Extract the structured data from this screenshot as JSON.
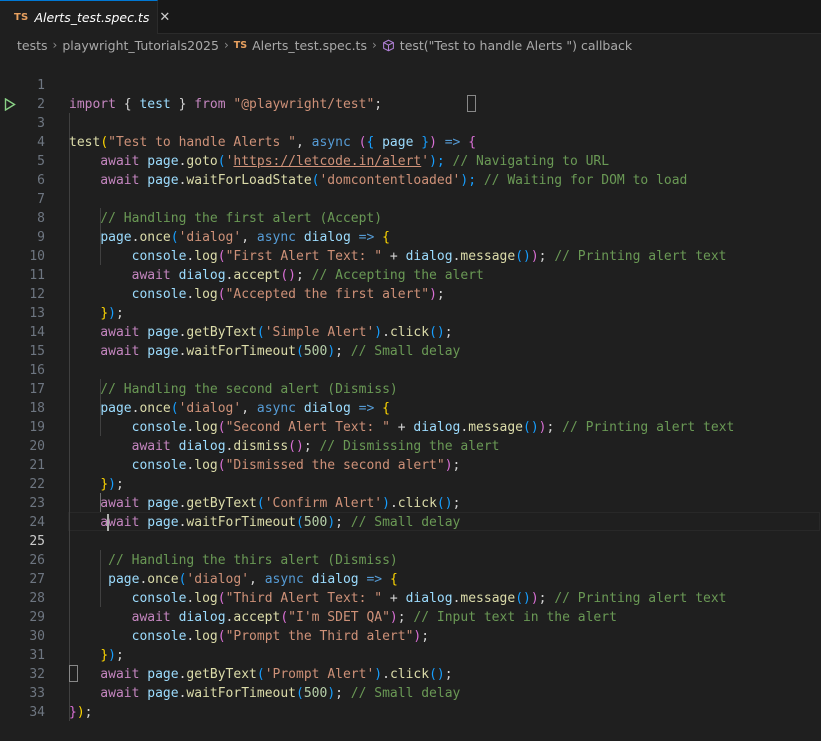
{
  "tab": {
    "badge": "TS",
    "title": "Alerts_test.spec.ts",
    "close": "✕"
  },
  "breadcrumb": {
    "items": [
      "tests",
      "playwright_Tutorials2025",
      "Alerts_test.spec.ts",
      "test(\"Test to handle Alerts \") callback"
    ],
    "ts_badge": "TS",
    "separator": "›"
  },
  "editor": {
    "active_line": 25,
    "lines": [
      {
        "n": "1"
      },
      {
        "n": "2"
      },
      {
        "n": "3"
      },
      {
        "n": "4"
      },
      {
        "n": "5"
      },
      {
        "n": "6"
      },
      {
        "n": "7"
      },
      {
        "n": "8"
      },
      {
        "n": "9"
      },
      {
        "n": "10"
      },
      {
        "n": "11"
      },
      {
        "n": "12"
      },
      {
        "n": "13"
      },
      {
        "n": "14"
      },
      {
        "n": "15"
      },
      {
        "n": "16"
      },
      {
        "n": "17"
      },
      {
        "n": "18"
      },
      {
        "n": "19"
      },
      {
        "n": "20"
      },
      {
        "n": "21"
      },
      {
        "n": "22"
      },
      {
        "n": "23"
      },
      {
        "n": "24"
      },
      {
        "n": "25"
      },
      {
        "n": "26"
      },
      {
        "n": "27"
      },
      {
        "n": "28"
      },
      {
        "n": "29"
      },
      {
        "n": "30"
      },
      {
        "n": "31"
      },
      {
        "n": "32"
      },
      {
        "n": "33"
      },
      {
        "n": "34"
      }
    ],
    "code": {
      "l1": [
        "import",
        " { ",
        "test",
        " } ",
        "from",
        " ",
        "\"@playwright/test\"",
        ";"
      ],
      "l3": [
        "test",
        "(",
        "\"Test to handle Alerts \"",
        ", ",
        "async",
        " ",
        "(",
        "{ ",
        "page",
        " }",
        ")",
        " => ",
        "{"
      ],
      "l4": [
        "    await ",
        "page",
        ".",
        "goto",
        "(",
        "'",
        "https://letcode.in/alert",
        "'",
        ");",
        " // Navigating to URL"
      ],
      "l5": [
        "    await ",
        "page",
        ".",
        "waitForLoadState",
        "(",
        "'domcontentloaded'",
        ");",
        " // Waiting for DOM to load"
      ],
      "l7": [
        "    // Handling the first alert (Accept)"
      ],
      "l8": [
        "    ",
        "page",
        ".",
        "once",
        "(",
        "'dialog'",
        ", ",
        "async",
        " ",
        "dialog",
        " => ",
        "{"
      ],
      "l9": [
        "        ",
        "console",
        ".",
        "log",
        "(",
        "\"First Alert Text: \"",
        " + ",
        "dialog",
        ".",
        "message",
        "(",
        ")",
        ")",
        ";",
        " // Printing alert text"
      ],
      "l10": [
        "        await ",
        "dialog",
        ".",
        "accept",
        "(",
        ")",
        ";",
        " // Accepting the alert"
      ],
      "l11": [
        "        ",
        "console",
        ".",
        "log",
        "(",
        "\"Accepted the first alert\"",
        ")",
        ";"
      ],
      "l12": [
        "    ",
        "}",
        ")",
        ";"
      ],
      "l13": [
        "    await ",
        "page",
        ".",
        "getByText",
        "(",
        "'Simple Alert'",
        ")",
        ".",
        "click",
        "(",
        ")",
        ";"
      ],
      "l14": [
        "    await ",
        "page",
        ".",
        "waitForTimeout",
        "(",
        "500",
        ")",
        ";",
        " // Small delay"
      ],
      "l16": [
        "    // Handling the second alert (Dismiss)"
      ],
      "l17": [
        "    ",
        "page",
        ".",
        "once",
        "(",
        "'dialog'",
        ", ",
        "async",
        " ",
        "dialog",
        " => ",
        "{"
      ],
      "l18": [
        "        ",
        "console",
        ".",
        "log",
        "(",
        "\"Second Alert Text: \"",
        " + ",
        "dialog",
        ".",
        "message",
        "(",
        ")",
        ")",
        ";",
        " // Printing alert text"
      ],
      "l19": [
        "        await ",
        "dialog",
        ".",
        "dismiss",
        "(",
        ")",
        ";",
        " // Dismissing the alert"
      ],
      "l20": [
        "        ",
        "console",
        ".",
        "log",
        "(",
        "\"Dismissed the second alert\"",
        ")",
        ";"
      ],
      "l21": [
        "    ",
        "}",
        ")",
        ";"
      ],
      "l22": [
        "    await ",
        "page",
        ".",
        "getByText",
        "(",
        "'Confirm Alert'",
        ")",
        ".",
        "click",
        "(",
        ")",
        ";"
      ],
      "l23": [
        "    await ",
        "page",
        ".",
        "waitForTimeout",
        "(",
        "500",
        ")",
        ";",
        " // Small delay"
      ],
      "l25": [
        "     // Handling the thirs alert (Dismiss)"
      ],
      "l26": [
        "     ",
        "page",
        ".",
        "once",
        "(",
        "'dialog'",
        ", ",
        "async",
        " ",
        "dialog",
        " => ",
        "{"
      ],
      "l27": [
        "        ",
        "console",
        ".",
        "log",
        "(",
        "\"Third Alert Text: \"",
        " + ",
        "dialog",
        ".",
        "message",
        "(",
        ")",
        ")",
        ";",
        " // Printing alert text"
      ],
      "l28": [
        "        await ",
        "dialog",
        ".",
        "accept",
        "(",
        "\"I'm SDET QA\"",
        ")",
        ";",
        " // Input text in the alert"
      ],
      "l29": [
        "        ",
        "console",
        ".",
        "log",
        "(",
        "\"Prompt the Third alert\"",
        ")",
        ";"
      ],
      "l30": [
        "    ",
        "}",
        ")",
        ";"
      ],
      "l31": [
        "    await ",
        "page",
        ".",
        "getByText",
        "(",
        "'Prompt Alert'",
        ")",
        ".",
        "click",
        "(",
        ")",
        ";"
      ],
      "l32": [
        "    await ",
        "page",
        ".",
        "waitForTimeout",
        "(",
        "500",
        ")",
        ";",
        " // Small delay"
      ],
      "l33": [
        "}",
        ")",
        ";"
      ]
    }
  },
  "colors": {
    "accent": "#0078d4",
    "background": "#1f1f1f",
    "ts_badge": "#e8a05f",
    "run_icon": "#89d185"
  },
  "icons": [
    "close-icon",
    "chevron-right-icon",
    "cube-icon",
    "run-test-icon"
  ]
}
